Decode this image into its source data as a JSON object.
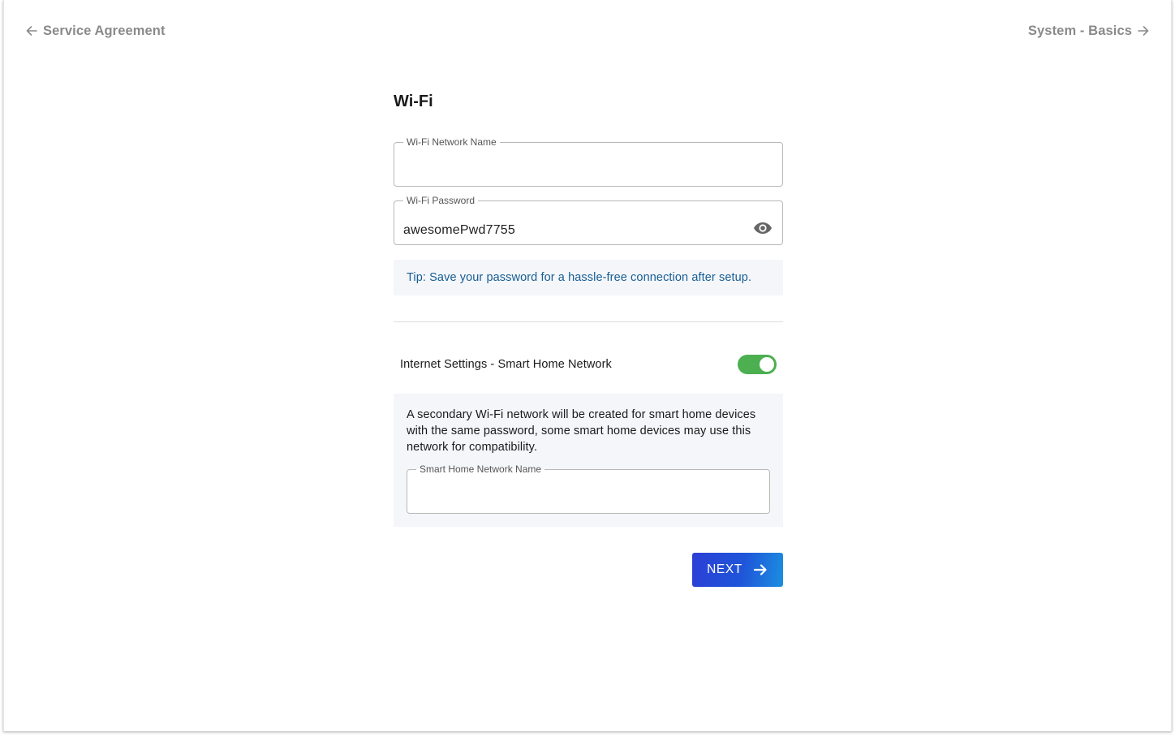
{
  "nav": {
    "prev_label": "Service Agreement",
    "next_label": "System - Basics"
  },
  "wifi": {
    "title": "Wi-Fi",
    "network_name": {
      "label": "Wi-Fi Network Name",
      "value": ""
    },
    "password": {
      "label": "Wi-Fi Password",
      "value": "awesomePwd7755",
      "visibility_icon": "eye-icon"
    },
    "tip": "Tip: Save your password for a hassle-free connection after setup."
  },
  "smart_home": {
    "toggle_label": "Internet Settings - Smart Home Network",
    "toggle_on": true,
    "description": "A secondary Wi-Fi network will be created for smart home devices with the same password, some smart home devices may use this network for compatibility.",
    "network_name": {
      "label": "Smart Home Network Name",
      "value": ""
    }
  },
  "actions": {
    "next_label": "NEXT"
  },
  "colors": {
    "toggle_on": "#4caf50",
    "tip_text": "#175e93",
    "panel_bg": "#f4f6fa",
    "button_start": "#2b3fd6",
    "button_end": "#1b8fe0"
  }
}
